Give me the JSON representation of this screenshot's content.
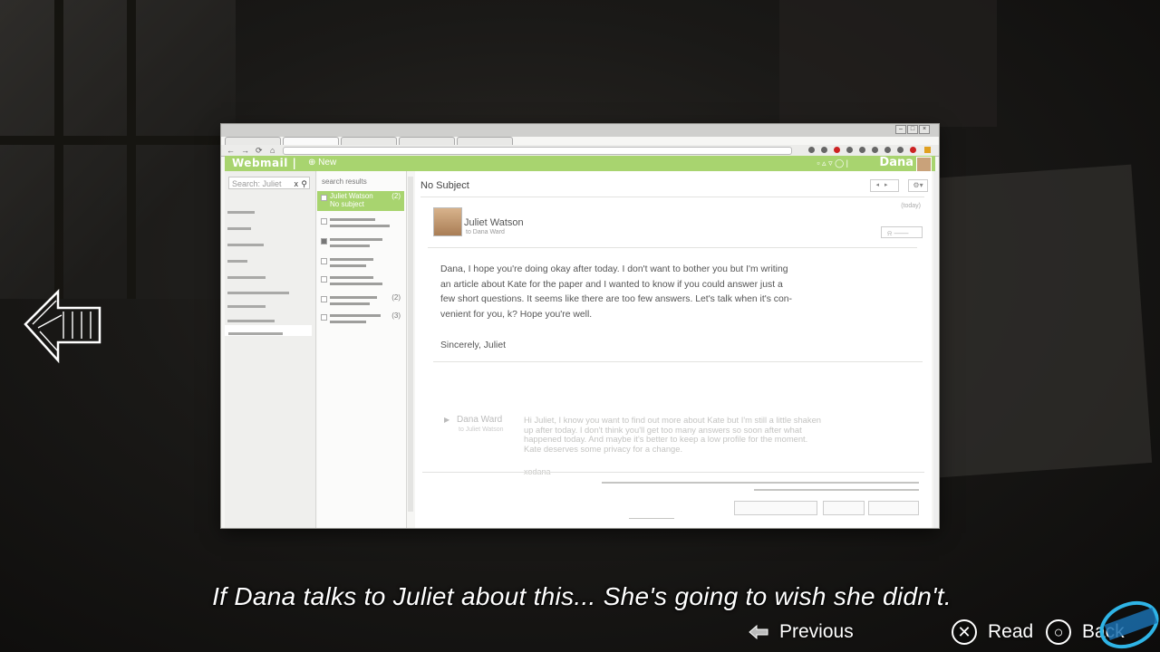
{
  "webmail": {
    "brand": "Webmail |",
    "new_label": "⊕ New",
    "user_name": "Dana",
    "search_value": "Search: Juliet",
    "results_label": "search results",
    "results": [
      {
        "from": "Juliet Watson",
        "subject": "No subject",
        "count": "(2)"
      },
      {
        "from": "",
        "subject": "",
        "count": ""
      },
      {
        "from": "",
        "subject": "",
        "count": ""
      },
      {
        "from": "",
        "subject": "",
        "count": ""
      },
      {
        "from": "",
        "subject": "",
        "count": ""
      },
      {
        "from": "",
        "subject": "",
        "count": "(2)"
      },
      {
        "from": "",
        "subject": "",
        "count": "(3)"
      }
    ]
  },
  "message": {
    "subject": "No Subject",
    "sender": "Juliet Watson",
    "recipient": "to Dana Ward",
    "date": "(today)",
    "body": "Dana, I hope you're doing okay after today. I don't want to bother you but I'm writing\nan article about Kate for the paper and I wanted to know if you could answer just a\nfew short questions. It seems like there are too few answers. Let's talk when it's con-\nvenient for you, k? Hope you're well.",
    "signoff": "Sincerely, Juliet",
    "quoted": {
      "name": "Dana Ward",
      "to": "to Juliet Watson",
      "text": "Hi Juliet, I know you want to find out more about Kate but I'm still a little shaken\nup after today. I don't think you'll get too many answers so soon after what\nhappened today. And maybe it's better to keep a low profile for the moment.\nKate deserves some privacy for a change.",
      "signature": "xodana"
    }
  },
  "subtitle": "If Dana talks to Juliet about this...  She's going to wish she didn't.",
  "prompts": {
    "previous": "Previous",
    "read": "Read",
    "back": "Back",
    "read_button_icon": "cross-button-icon",
    "back_button_icon": "circle-button-icon"
  },
  "colors": {
    "accent_green": "#a8d46f",
    "subtitle": "#ffffff"
  }
}
